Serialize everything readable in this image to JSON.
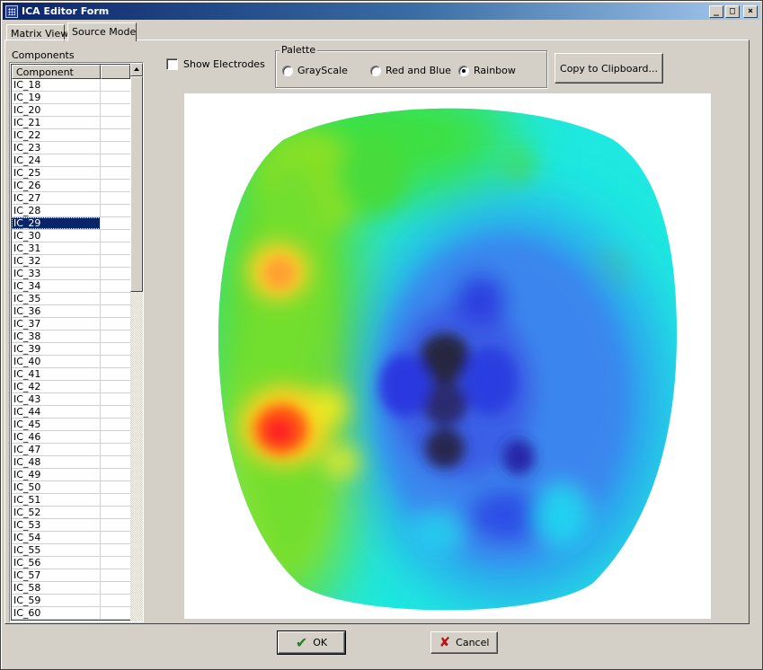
{
  "window": {
    "title": "ICA Editor Form",
    "controls": {
      "minimize": "_",
      "maximize": "□",
      "close": "×"
    }
  },
  "tabs": [
    {
      "label": "Matrix View",
      "active": false
    },
    {
      "label": "Source Mode",
      "active": true
    }
  ],
  "components": {
    "label": "Components",
    "column_header": "Component",
    "selected": "IC_29",
    "items": [
      "IC_18",
      "IC_19",
      "IC_20",
      "IC_21",
      "IC_22",
      "IC_23",
      "IC_24",
      "IC_25",
      "IC_26",
      "IC_27",
      "IC_28",
      "IC_29",
      "IC_30",
      "IC_31",
      "IC_32",
      "IC_33",
      "IC_34",
      "IC_35",
      "IC_36",
      "IC_37",
      "IC_38",
      "IC_39",
      "IC_40",
      "IC_41",
      "IC_42",
      "IC_43",
      "IC_44",
      "IC_45",
      "IC_46",
      "IC_47",
      "IC_48",
      "IC_49",
      "IC_50",
      "IC_51",
      "IC_52",
      "IC_53",
      "IC_54",
      "IC_55",
      "IC_56",
      "IC_57",
      "IC_58",
      "IC_59",
      "IC_60"
    ]
  },
  "show_electrodes": {
    "label": "Show Electrodes",
    "checked": false
  },
  "palette": {
    "label": "Palette",
    "options": [
      "GrayScale",
      "Red and Blue",
      "Rainbow"
    ],
    "selected": "Rainbow"
  },
  "copy_button": "Copy to Clipboard...",
  "ok_button": "OK",
  "cancel_button": "Cancel",
  "colors": {
    "titlebar_start": "#0a246a",
    "titlebar_end": "#a6caf0",
    "selection": "#0a246a",
    "face": "#d4d0c8"
  },
  "icons": {
    "app": "grid-app-icon",
    "ok": "checkmark-icon",
    "cancel": "x-cross-icon"
  }
}
